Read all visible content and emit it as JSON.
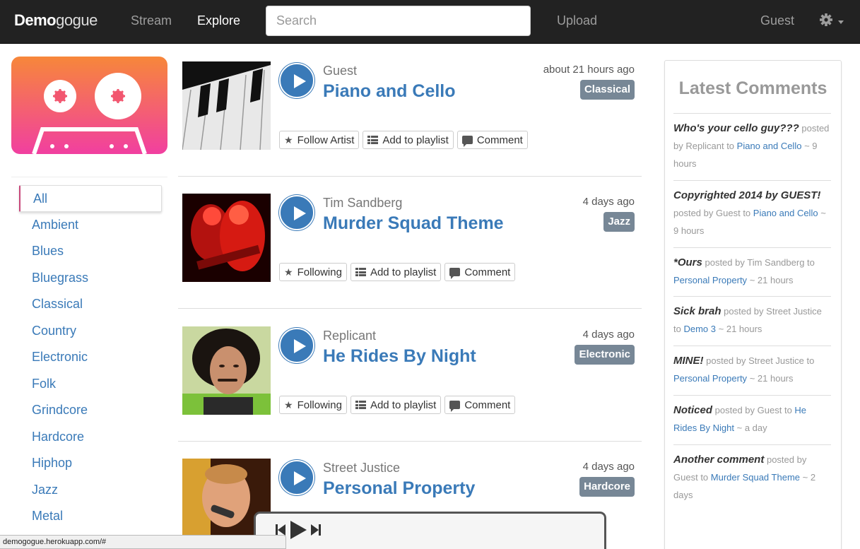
{
  "navbar": {
    "brand_bold": "Demo",
    "brand_light": "gogue",
    "links": [
      "Stream",
      "Explore"
    ],
    "active_link": "Explore",
    "search_placeholder": "Search",
    "upload": "Upload",
    "user": "Guest",
    "settings_icon": "gear-icon"
  },
  "sidebar": {
    "logo": "cassette-logo",
    "genres": [
      "All",
      "Ambient",
      "Blues",
      "Bluegrass",
      "Classical",
      "Country",
      "Electronic",
      "Folk",
      "Grindcore",
      "Hardcore",
      "Hiphop",
      "Jazz",
      "Metal"
    ],
    "active_genre": "All"
  },
  "tracks": [
    {
      "artist": "Guest",
      "title": "Piano and Cello",
      "time": "about 21 hours ago",
      "genre": "Classical",
      "actions": {
        "follow": "Follow Artist",
        "playlist": "Add to playlist",
        "comment": "Comment"
      }
    },
    {
      "artist": "Tim Sandberg",
      "title": "Murder Squad Theme",
      "time": "4 days ago",
      "genre": "Jazz",
      "actions": {
        "follow": "Following",
        "playlist": "Add to playlist",
        "comment": "Comment"
      }
    },
    {
      "artist": "Replicant",
      "title": "He Rides By Night",
      "time": "4 days ago",
      "genre": "Electronic",
      "actions": {
        "follow": "Following",
        "playlist": "Add to playlist",
        "comment": "Comment"
      }
    },
    {
      "artist": "Street Justice",
      "title": "Personal Property",
      "time": "4 days ago",
      "genre": "Hardcore"
    }
  ],
  "comments_panel": {
    "title": "Latest Comments",
    "comments": [
      {
        "text": "Who's your cello guy???",
        "by": "Replicant",
        "track": "Piano and Cello",
        "ago": "9 hours"
      },
      {
        "text": "Copyrighted 2014 by GUEST!",
        "by": "Guest",
        "track": "Piano and Cello",
        "ago": "9 hours"
      },
      {
        "text": "*Ours",
        "by": "Tim Sandberg",
        "track": "Personal Property",
        "ago": "21 hours"
      },
      {
        "text": "Sick brah",
        "by": "Street Justice",
        "track": "Demo 3",
        "ago": "21 hours"
      },
      {
        "text": "MINE!",
        "by": "Street Justice",
        "track": "Personal Property",
        "ago": "21 hours"
      },
      {
        "text": "Noticed",
        "by": "Guest",
        "track": "He Rides By Night",
        "ago": "a day"
      },
      {
        "text": "Another comment",
        "by": "Guest",
        "track": "Murder Squad Theme",
        "ago": "2 days"
      }
    ],
    "posted_by": "posted by",
    "to": "to",
    "sep": "~"
  },
  "player": {
    "controls": [
      "previous-icon",
      "play-icon",
      "next-icon"
    ]
  },
  "status_bar": "demogogue.herokuapp.com/#"
}
